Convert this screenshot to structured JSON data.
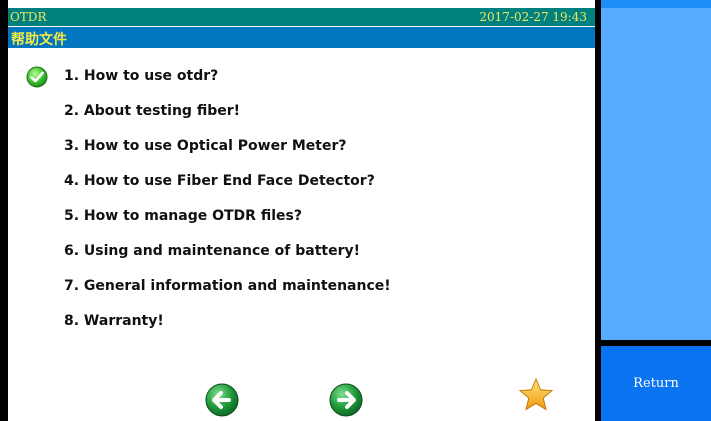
{
  "titlebar": {
    "app_title": "OTDR",
    "datetime": "2017-02-27 19:43"
  },
  "subtitle": "帮助文件",
  "topics": [
    "1. How to use otdr?",
    "2. About testing fiber!",
    "3. How to use Optical Power Meter?",
    "4. How to use Fiber End Face Detector?",
    "5. How to manage OTDR files?",
    "6. Using and maintenance of battery!",
    "7. General information and maintenance!",
    "8. Warranty!"
  ],
  "selected_topic_index": 0,
  "icons": {
    "selected": "check-circle-icon",
    "back": "arrow-left-circle-icon",
    "forward": "arrow-right-circle-icon",
    "favorite": "star-icon"
  },
  "colors": {
    "titlebar_bg": "#00807e",
    "title_text": "#f0e85c",
    "subtitle_bg": "#0277c0",
    "subtitle_text": "#f4ea44",
    "side_top": "#57acff",
    "side_button": "#0a74f0",
    "nav_green": "#1f8a3a",
    "star": "#f5b221"
  },
  "sidebar": {
    "return_label": "Return"
  }
}
